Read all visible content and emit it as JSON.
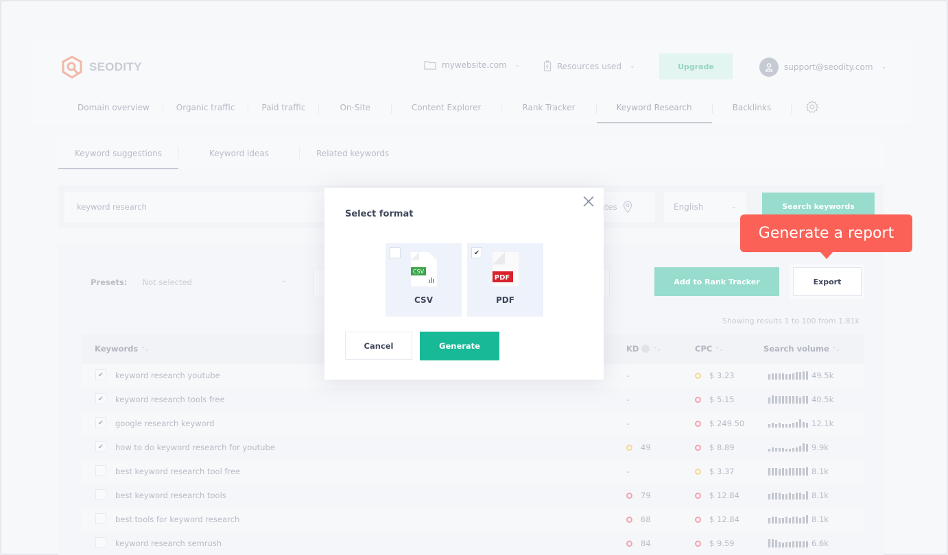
{
  "brand": {
    "name": "SEODITY"
  },
  "topbar": {
    "project": "mywebsite.com",
    "resources": "Resources used",
    "upgrade": "Upgrade",
    "user_email": "support@seodity.com"
  },
  "nav": {
    "items": [
      {
        "label": "Domain overview"
      },
      {
        "label": "Organic traffic"
      },
      {
        "label": "Paid traffic"
      },
      {
        "label": "On-Site"
      },
      {
        "label": "Content Explorer"
      },
      {
        "label": "Rank Tracker"
      },
      {
        "label": "Keyword Research",
        "active": true
      },
      {
        "label": "Backlinks"
      }
    ]
  },
  "subtabs": [
    {
      "label": "Keyword suggestions",
      "active": true
    },
    {
      "label": "Keyword ideas"
    },
    {
      "label": "Related keywords"
    }
  ],
  "search": {
    "query": "keyword research",
    "location_partial": "ates",
    "language": "English",
    "button": "Search keywords"
  },
  "toolbar": {
    "presets_label": "Presets:",
    "presets_value": "Not selected",
    "add_rank_tracker": "Add to Rank Tracker",
    "export": "Export",
    "showing": "Showing results 1 to 100 from 1.81k"
  },
  "table": {
    "headers": {
      "keywords": "Keywords",
      "kd": "KD",
      "cpc": "CPC",
      "volume": "Search volume"
    },
    "rows": [
      {
        "checked": true,
        "keyword": "keyword research youtube",
        "kd": "-",
        "kd_color": "",
        "cpc": "$ 3.23",
        "cpc_color": "#f5d98a",
        "volume": "49.5k",
        "trend": [
          5,
          6,
          6,
          6,
          6,
          5,
          5,
          6,
          7,
          7,
          8,
          8
        ]
      },
      {
        "checked": true,
        "keyword": "keyword research tools free",
        "kd": "-",
        "kd_color": "",
        "cpc": "$ 5.15",
        "cpc_color": "#f2a3ad",
        "volume": "40.5k",
        "trend": [
          6,
          8,
          7,
          7,
          7,
          7,
          7,
          7,
          7,
          6,
          7,
          7
        ]
      },
      {
        "checked": true,
        "keyword": "google research keyword",
        "kd": "-",
        "kd_color": "",
        "cpc": "$ 249.50",
        "cpc_color": "#f2a3ad",
        "volume": "12.1k",
        "trend": [
          4,
          5,
          4,
          5,
          4,
          4,
          4,
          5,
          6,
          9,
          6,
          5
        ]
      },
      {
        "checked": true,
        "keyword": "how to do keyword research for youtube",
        "kd": "49",
        "kd_color": "#f5d98a",
        "cpc": "$ 8.89",
        "cpc_color": "#f2a3ad",
        "volume": "9.9k",
        "trend": [
          3,
          5,
          4,
          4,
          4,
          3,
          3,
          4,
          5,
          7,
          10,
          9
        ]
      },
      {
        "checked": false,
        "keyword": "best keyword research tool free",
        "kd": "-",
        "kd_color": "",
        "cpc": "$ 3.37",
        "cpc_color": "#f5d98a",
        "volume": "8.1k",
        "trend": [
          9,
          9,
          9,
          8,
          9,
          8,
          9,
          9,
          9,
          9,
          9,
          10
        ]
      },
      {
        "checked": false,
        "keyword": "best keyword research tools",
        "kd": "79",
        "kd_color": "#f2a3ad",
        "cpc": "$ 12.84",
        "cpc_color": "#f2a3ad",
        "volume": "8.1k",
        "trend": [
          7,
          8,
          8,
          8,
          7,
          7,
          8,
          7,
          8,
          8,
          7,
          10
        ]
      },
      {
        "checked": false,
        "keyword": "best tools for keyword research",
        "kd": "68",
        "kd_color": "#f2a3ad",
        "cpc": "$ 12.84",
        "cpc_color": "#f2a3ad",
        "volume": "8.1k",
        "trend": [
          7,
          8,
          8,
          7,
          7,
          8,
          7,
          8,
          8,
          7,
          8,
          10
        ]
      },
      {
        "checked": false,
        "keyword": "keyword research semrush",
        "kd": "84",
        "kd_color": "#f2a3ad",
        "cpc": "$ 9.59",
        "cpc_color": "#f2a3ad",
        "volume": "6.6k",
        "trend": [
          9,
          9,
          8,
          6,
          5,
          6,
          6,
          7,
          7,
          7,
          7,
          7
        ]
      }
    ]
  },
  "modal": {
    "title": "Select format",
    "formats": [
      {
        "label": "CSV",
        "badge": "CSV",
        "checked": false,
        "color": "#3ca54a"
      },
      {
        "label": "PDF",
        "badge": "PDF",
        "checked": true,
        "color": "#d8232a"
      }
    ],
    "cancel": "Cancel",
    "generate": "Generate"
  },
  "tooltip": {
    "text": "Generate a report",
    "color": "#fc6157"
  }
}
